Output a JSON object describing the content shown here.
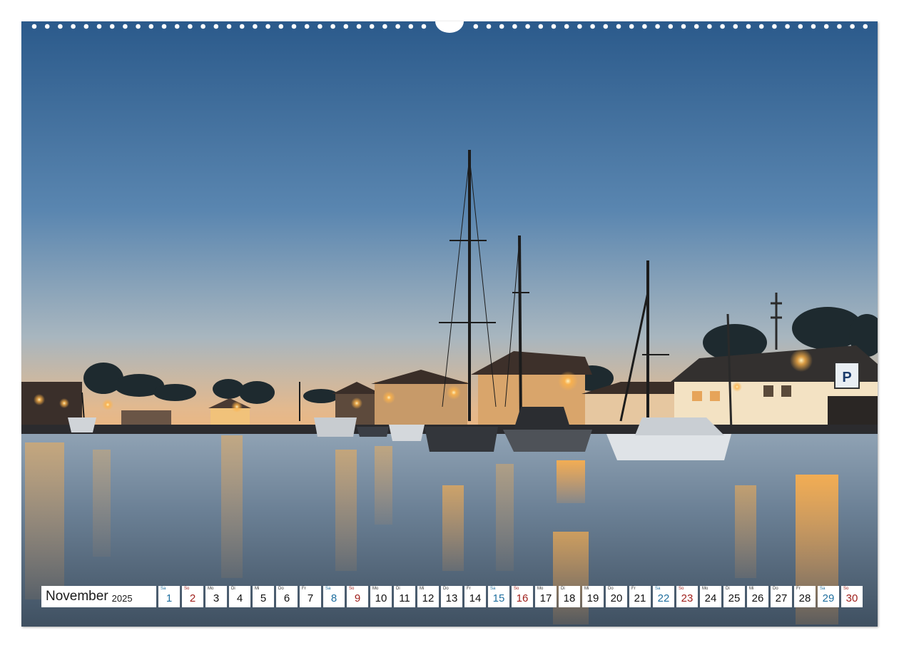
{
  "calendar": {
    "month": "November",
    "year": "2025",
    "days": [
      {
        "wd": "Sa",
        "num": "1",
        "type": "sat"
      },
      {
        "wd": "So",
        "num": "2",
        "type": "sun"
      },
      {
        "wd": "Mo",
        "num": "3",
        "type": ""
      },
      {
        "wd": "Di",
        "num": "4",
        "type": ""
      },
      {
        "wd": "Mi",
        "num": "5",
        "type": ""
      },
      {
        "wd": "Do",
        "num": "6",
        "type": ""
      },
      {
        "wd": "Fr",
        "num": "7",
        "type": ""
      },
      {
        "wd": "Sa",
        "num": "8",
        "type": "sat"
      },
      {
        "wd": "So",
        "num": "9",
        "type": "sun"
      },
      {
        "wd": "Mo",
        "num": "10",
        "type": ""
      },
      {
        "wd": "Di",
        "num": "11",
        "type": ""
      },
      {
        "wd": "Mi",
        "num": "12",
        "type": ""
      },
      {
        "wd": "Do",
        "num": "13",
        "type": ""
      },
      {
        "wd": "Fr",
        "num": "14",
        "type": ""
      },
      {
        "wd": "Sa",
        "num": "15",
        "type": "sat"
      },
      {
        "wd": "So",
        "num": "16",
        "type": "sun"
      },
      {
        "wd": "Mo",
        "num": "17",
        "type": ""
      },
      {
        "wd": "Di",
        "num": "18",
        "type": ""
      },
      {
        "wd": "Mi",
        "num": "19",
        "type": ""
      },
      {
        "wd": "Do",
        "num": "20",
        "type": ""
      },
      {
        "wd": "Fr",
        "num": "21",
        "type": ""
      },
      {
        "wd": "Sa",
        "num": "22",
        "type": "sat"
      },
      {
        "wd": "So",
        "num": "23",
        "type": "sun"
      },
      {
        "wd": "Mo",
        "num": "24",
        "type": ""
      },
      {
        "wd": "Di",
        "num": "25",
        "type": ""
      },
      {
        "wd": "Mi",
        "num": "26",
        "type": ""
      },
      {
        "wd": "Do",
        "num": "27",
        "type": ""
      },
      {
        "wd": "Fr",
        "num": "28",
        "type": ""
      },
      {
        "wd": "Sa",
        "num": "29",
        "type": "sat"
      },
      {
        "wd": "So",
        "num": "30",
        "type": "sun"
      }
    ]
  },
  "photo": {
    "subject": "harbor-at-dusk-with-sailboats",
    "sign_text": "P"
  },
  "colors": {
    "saturday": "#1f6f9f",
    "sunday": "#a0201c",
    "sky_top": "#2d5c8c",
    "sky_horizon": "#e8b98a",
    "light": "#ffb347"
  }
}
